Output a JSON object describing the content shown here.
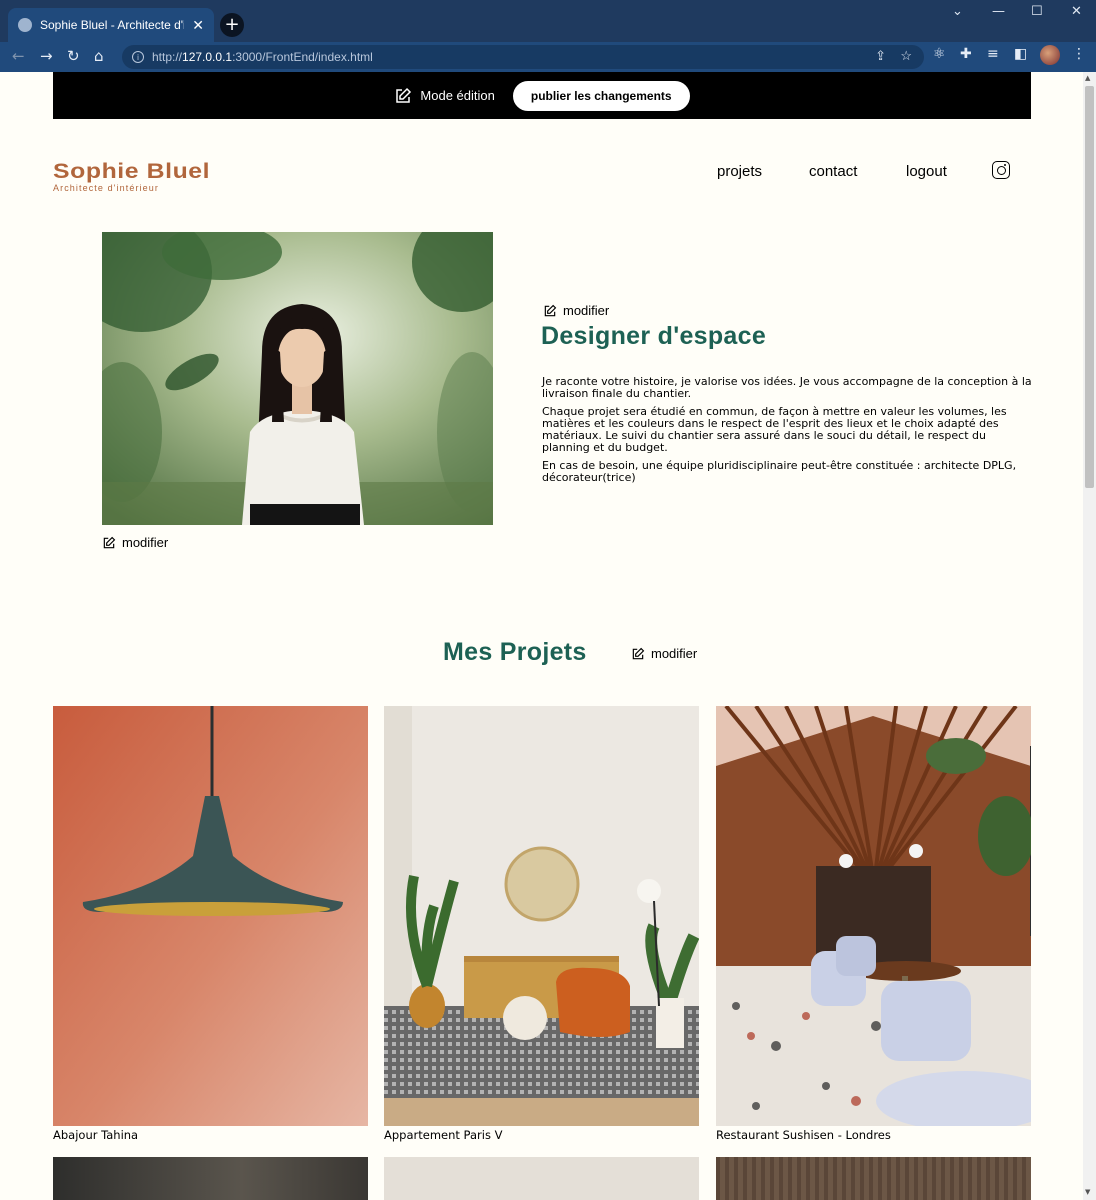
{
  "browser": {
    "tab_title": "Sophie Bluel - Architecte d'intérie",
    "tab_close": "✕",
    "new_tab": "+",
    "url_prefix": "http://",
    "url_host": "127.0.0.1",
    "url_path": ":3000/FrontEnd/index.html",
    "window_controls": [
      "⌄",
      "—",
      "☐",
      "✕"
    ]
  },
  "edit_bar": {
    "mode_label": "Mode édition",
    "publish_label": "publier les changements"
  },
  "header": {
    "logo_name": "Sophie Bluel",
    "logo_subtitle": "Architecte d'intérieur",
    "nav": [
      "projets",
      "contact",
      "logout"
    ]
  },
  "introduction": {
    "modify_photo_label": "modifier",
    "modify_text_label": "modifier",
    "title": "Designer d'espace",
    "paragraphs": [
      "Je raconte votre histoire, je valorise vos idées. Je vous accompagne de la conception à la livraison finale du chantier.",
      "Chaque projet sera étudié en commun, de façon à mettre en valeur les volumes, les matières et les couleurs dans le respect de l'esprit des lieux et le choix adapté des matériaux. Le suivi du chantier sera assuré dans le souci du détail, le respect du planning et du budget.",
      "En cas de besoin, une équipe pluridisciplinaire peut-être constituée : architecte DPLG, décorateur(trice)"
    ]
  },
  "portfolio": {
    "title": "Mes Projets",
    "modify_label": "modifier",
    "works": [
      {
        "caption": "Abajour Tahina"
      },
      {
        "caption": "Appartement Paris V"
      },
      {
        "caption": "Restaurant Sushisen - Londres"
      }
    ]
  },
  "colors": {
    "brand": "#b1663c",
    "accent": "#1d6154",
    "background": "#fffef8"
  }
}
